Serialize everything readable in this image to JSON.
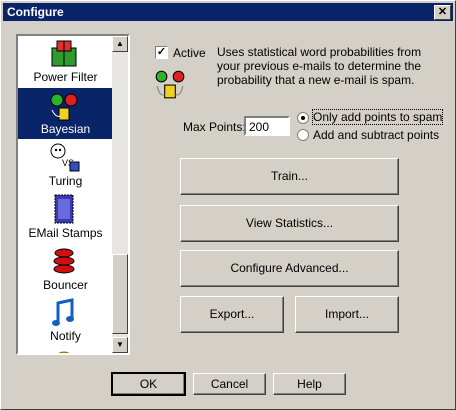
{
  "window": {
    "title": "Configure",
    "close_glyph": "✕"
  },
  "filters": [
    {
      "label": "Power Filter",
      "icon": "power-filter-icon",
      "selected": false
    },
    {
      "label": "Bayesian",
      "icon": "bayesian-icon",
      "selected": true
    },
    {
      "label": "Turing",
      "icon": "turing-icon",
      "selected": false
    },
    {
      "label": "EMail Stamps",
      "icon": "email-stamps-icon",
      "selected": false
    },
    {
      "label": "Bouncer",
      "icon": "bouncer-icon",
      "selected": false
    },
    {
      "label": "Notify",
      "icon": "notify-icon",
      "selected": false
    }
  ],
  "active": {
    "label": "Active",
    "checked": true,
    "description": "Uses statistical word probabilities from your previous e-mails to determine the probability that a new e-mail is spam."
  },
  "max_points": {
    "label": "Max Points:",
    "value": "200"
  },
  "options": {
    "only_add": "Only add points to spam",
    "add_subtract": "Add and subtract points",
    "selected": "only_add"
  },
  "buttons": {
    "train": "Train...",
    "view_stats": "View Statistics...",
    "config_adv": "Configure Advanced...",
    "export": "Export...",
    "import": "Import...",
    "ok": "OK",
    "cancel": "Cancel",
    "help": "Help"
  }
}
